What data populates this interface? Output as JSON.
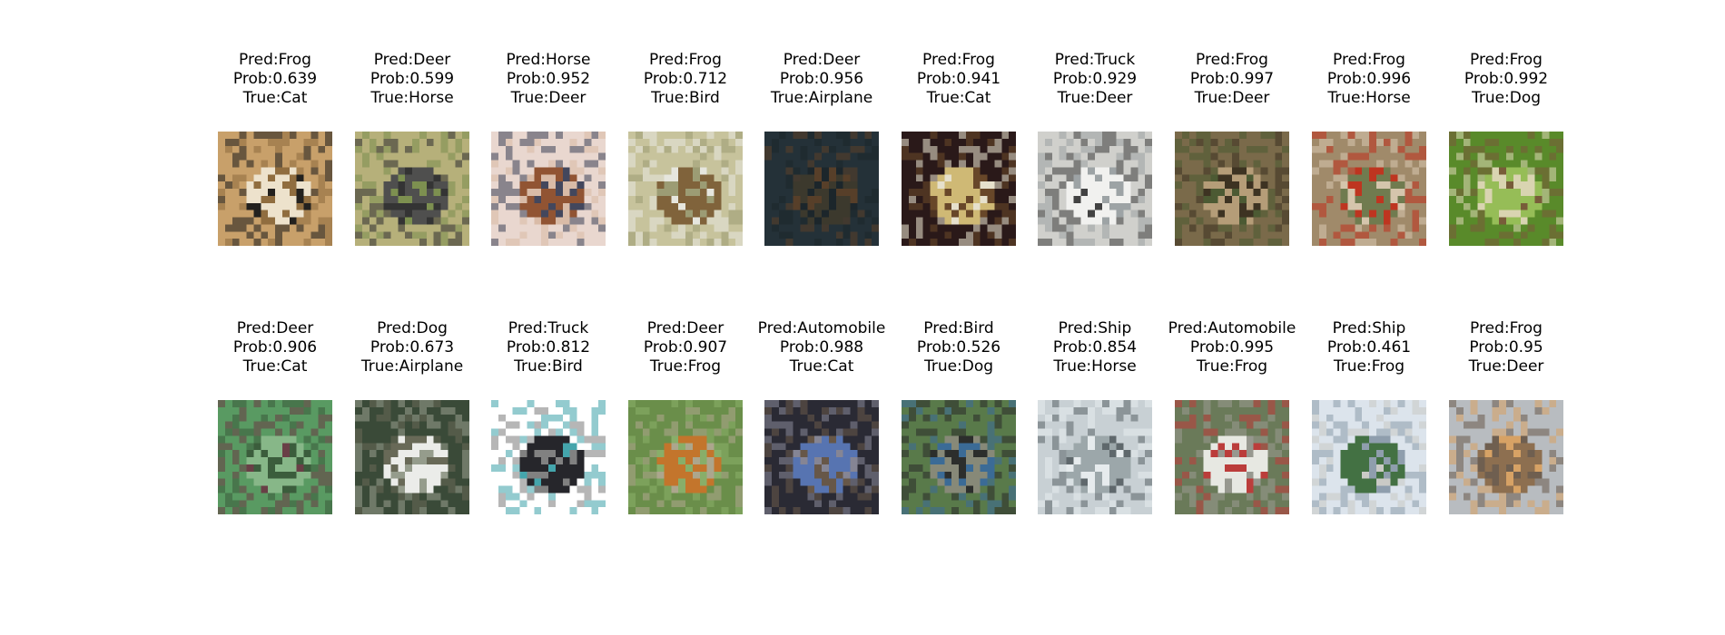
{
  "figure": {
    "rows": [
      [
        {
          "pred": "Pred:Frog",
          "prob": "Prob:0.639",
          "true": "True:Cat",
          "subject": "white cat lying on a brown surface",
          "palette": [
            "#c8a06a",
            "#efe6d2",
            "#1a1a1a",
            "#8d6a3d"
          ]
        },
        {
          "pred": "Pred:Deer",
          "prob": "Prob:0.599",
          "true": "True:Horse",
          "subject": "dark horse on a green field",
          "palette": [
            "#b6b07a",
            "#4a4a4c",
            "#7a8e4e",
            "#2d2d30"
          ]
        },
        {
          "pred": "Pred:Horse",
          "prob": "Prob:0.952",
          "true": "True:Deer",
          "subject": "brown deer standing in front of vehicles",
          "palette": [
            "#e9d7cf",
            "#8c4d2a",
            "#3a3f56",
            "#d8b9a4"
          ]
        },
        {
          "pred": "Pred:Frog",
          "prob": "Prob:0.712",
          "true": "True:Bird",
          "subject": "brown animal jumping a white fence",
          "palette": [
            "#c7c39c",
            "#7c5e36",
            "#e8e8e2",
            "#9a9a72"
          ]
        },
        {
          "pred": "Pred:Deer",
          "prob": "Prob:0.956",
          "true": "True:Airplane",
          "subject": "deer in a dark forest",
          "palette": [
            "#243238",
            "#3e3a2c",
            "#5b4028",
            "#1c262a"
          ]
        },
        {
          "pred": "Pred:Frog",
          "prob": "Prob:0.941",
          "true": "True:Cat",
          "subject": "bright round object on dark background",
          "palette": [
            "#2a1a1a",
            "#d8c27a",
            "#f0ebd6",
            "#6b4a2a"
          ]
        },
        {
          "pred": "Pred:Truck",
          "prob": "Prob:0.929",
          "true": "True:Deer",
          "subject": "white box truck",
          "palette": [
            "#d0d0cc",
            "#f2f2f0",
            "#3a3a3a",
            "#9aa0a2"
          ]
        },
        {
          "pred": "Pred:Frog",
          "prob": "Prob:0.997",
          "true": "True:Deer",
          "subject": "frog in leafy ground",
          "palette": [
            "#7a6a4a",
            "#b8a07a",
            "#4a5a32",
            "#3a3020"
          ]
        },
        {
          "pred": "Pred:Frog",
          "prob": "Prob:0.996",
          "true": "True:Horse",
          "subject": "frog with red markings",
          "palette": [
            "#a08a6a",
            "#6e7a4e",
            "#c0301c",
            "#d8c8b0"
          ]
        },
        {
          "pred": "Pred:Frog",
          "prob": "Prob:0.992",
          "true": "True:Dog",
          "subject": "animal head among green grass",
          "palette": [
            "#5a8a2a",
            "#9ac05a",
            "#7a5a3a",
            "#e0d8b8"
          ]
        }
      ],
      [
        {
          "pred": "Pred:Deer",
          "prob": "Prob:0.906",
          "true": "True:Cat",
          "subject": "deer among green water plants",
          "palette": [
            "#5a9a62",
            "#8ab88a",
            "#6a3a44",
            "#3a5a3a"
          ]
        },
        {
          "pred": "Pred:Dog",
          "prob": "Prob:0.673",
          "true": "True:Airplane",
          "subject": "white fluffy dog sitting",
          "palette": [
            "#3a4a38",
            "#f4f4f2",
            "#9aa090",
            "#6a6a58"
          ]
        },
        {
          "pred": "Pred:Truck",
          "prob": "Prob:0.812",
          "true": "True:Bird",
          "subject": "black truck on white background",
          "palette": [
            "#ffffff",
            "#1a1a20",
            "#3aa0a8",
            "#7a7a7a"
          ]
        },
        {
          "pred": "Pred:Deer",
          "prob": "Prob:0.907",
          "true": "True:Frog",
          "subject": "orange dog lying on grass",
          "palette": [
            "#6a8e4a",
            "#c8742a",
            "#8ab06a",
            "#b0a890"
          ]
        },
        {
          "pred": "Pred:Automobile",
          "prob": "Prob:0.988",
          "true": "True:Cat",
          "subject": "blue car at night",
          "palette": [
            "#2a2a34",
            "#5a78b8",
            "#8a8a9a",
            "#6a5a4a"
          ]
        },
        {
          "pred": "Pred:Bird",
          "prob": "Prob:0.526",
          "true": "True:Dog",
          "subject": "person beside a dark object",
          "palette": [
            "#5a7a4a",
            "#8a8a7a",
            "#2a2a2a",
            "#3a6a9a"
          ]
        },
        {
          "pred": "Pred:Ship",
          "prob": "Prob:0.854",
          "true": "True:Horse",
          "subject": "ship on calm water",
          "palette": [
            "#c8d0d4",
            "#9aa4a8",
            "#5a6266",
            "#e8ecee"
          ]
        },
        {
          "pred": "Pred:Automobile",
          "prob": "Prob:0.995",
          "true": "True:Frog",
          "subject": "white vintage car",
          "palette": [
            "#6a7a5a",
            "#eeeeea",
            "#9a9a92",
            "#c03a3a"
          ]
        },
        {
          "pred": "Pred:Ship",
          "prob": "Prob:0.461",
          "true": "True:Frog",
          "subject": "green truck on a street",
          "palette": [
            "#dce4ec",
            "#3a6a3a",
            "#c8c8c4",
            "#8a9aaa"
          ]
        },
        {
          "pred": "Pred:Frog",
          "prob": "Prob:0.95",
          "true": "True:Deer",
          "subject": "bird perched among flowers",
          "palette": [
            "#b8bcc0",
            "#8a6a4a",
            "#d8a060",
            "#6a5a4a"
          ]
        }
      ]
    ]
  }
}
